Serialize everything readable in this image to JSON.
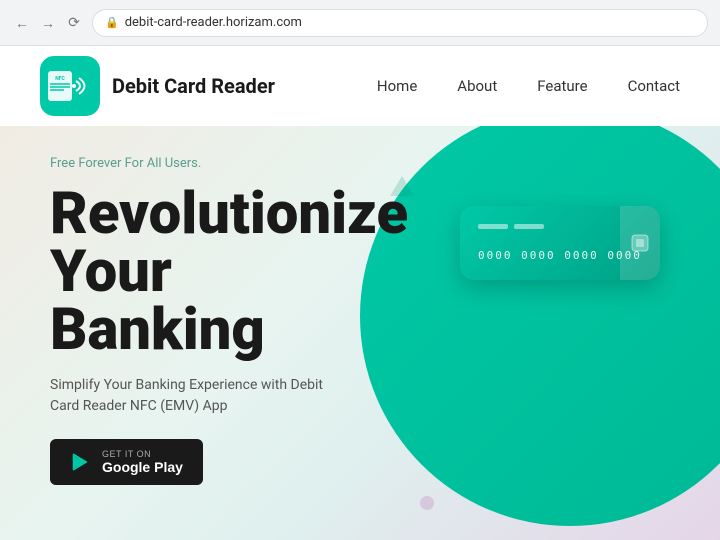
{
  "browser": {
    "url": "debit-card-reader.horizam.com",
    "lock_icon": "🔒"
  },
  "navbar": {
    "logo_text": "Debit Card Reader",
    "links": [
      {
        "label": "Home",
        "id": "home"
      },
      {
        "label": "About",
        "id": "about"
      },
      {
        "label": "Feature",
        "id": "feature"
      },
      {
        "label": "Contact",
        "id": "contact"
      }
    ]
  },
  "hero": {
    "badge": "Free Forever For All Users.",
    "title_line1": "Revolutionize",
    "title_line2": "Your",
    "title_line3": "Banking",
    "subtitle": "Simplify Your Banking Experience with Debit Card Reader NFC (EMV) App",
    "cta_small": "GET IT ON",
    "cta_large": "Google Play",
    "card_number": "0000 0000 0000 0000"
  }
}
